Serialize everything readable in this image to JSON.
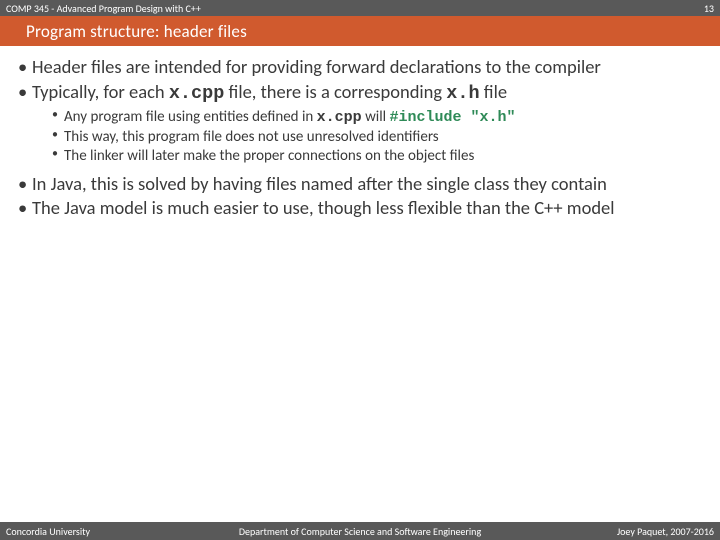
{
  "topbar": {
    "course": "COMP 345 - Advanced Program Design with C++",
    "page": "13"
  },
  "title": "Program structure: header files",
  "bullets": {
    "b1a": "Header files are intended for providing forward declarations to the compiler",
    "b2_pre": "Typically, for each ",
    "b2_code1": "x.cpp",
    "b2_mid": " file, there is a corresponding ",
    "b2_code2": "x.h",
    "b2_post": " file",
    "s1_pre": "Any program file using entities defined in ",
    "s1_code1": "x.cpp",
    "s1_mid": " will ",
    "s1_code2": "#include \"x.h\"",
    "s2": "This way, this program file does not use unresolved identifiers",
    "s3": "The linker will later make the proper connections on the object files",
    "b3": "In Java, this is solved by having files named after the single class they contain",
    "b4": "The Java model is much easier to use, though less flexible than the C++ model"
  },
  "footer": {
    "left": "Concordia University",
    "center": "Department of Computer Science and Software Engineering",
    "right": "Joey Paquet, 2007-2016"
  }
}
